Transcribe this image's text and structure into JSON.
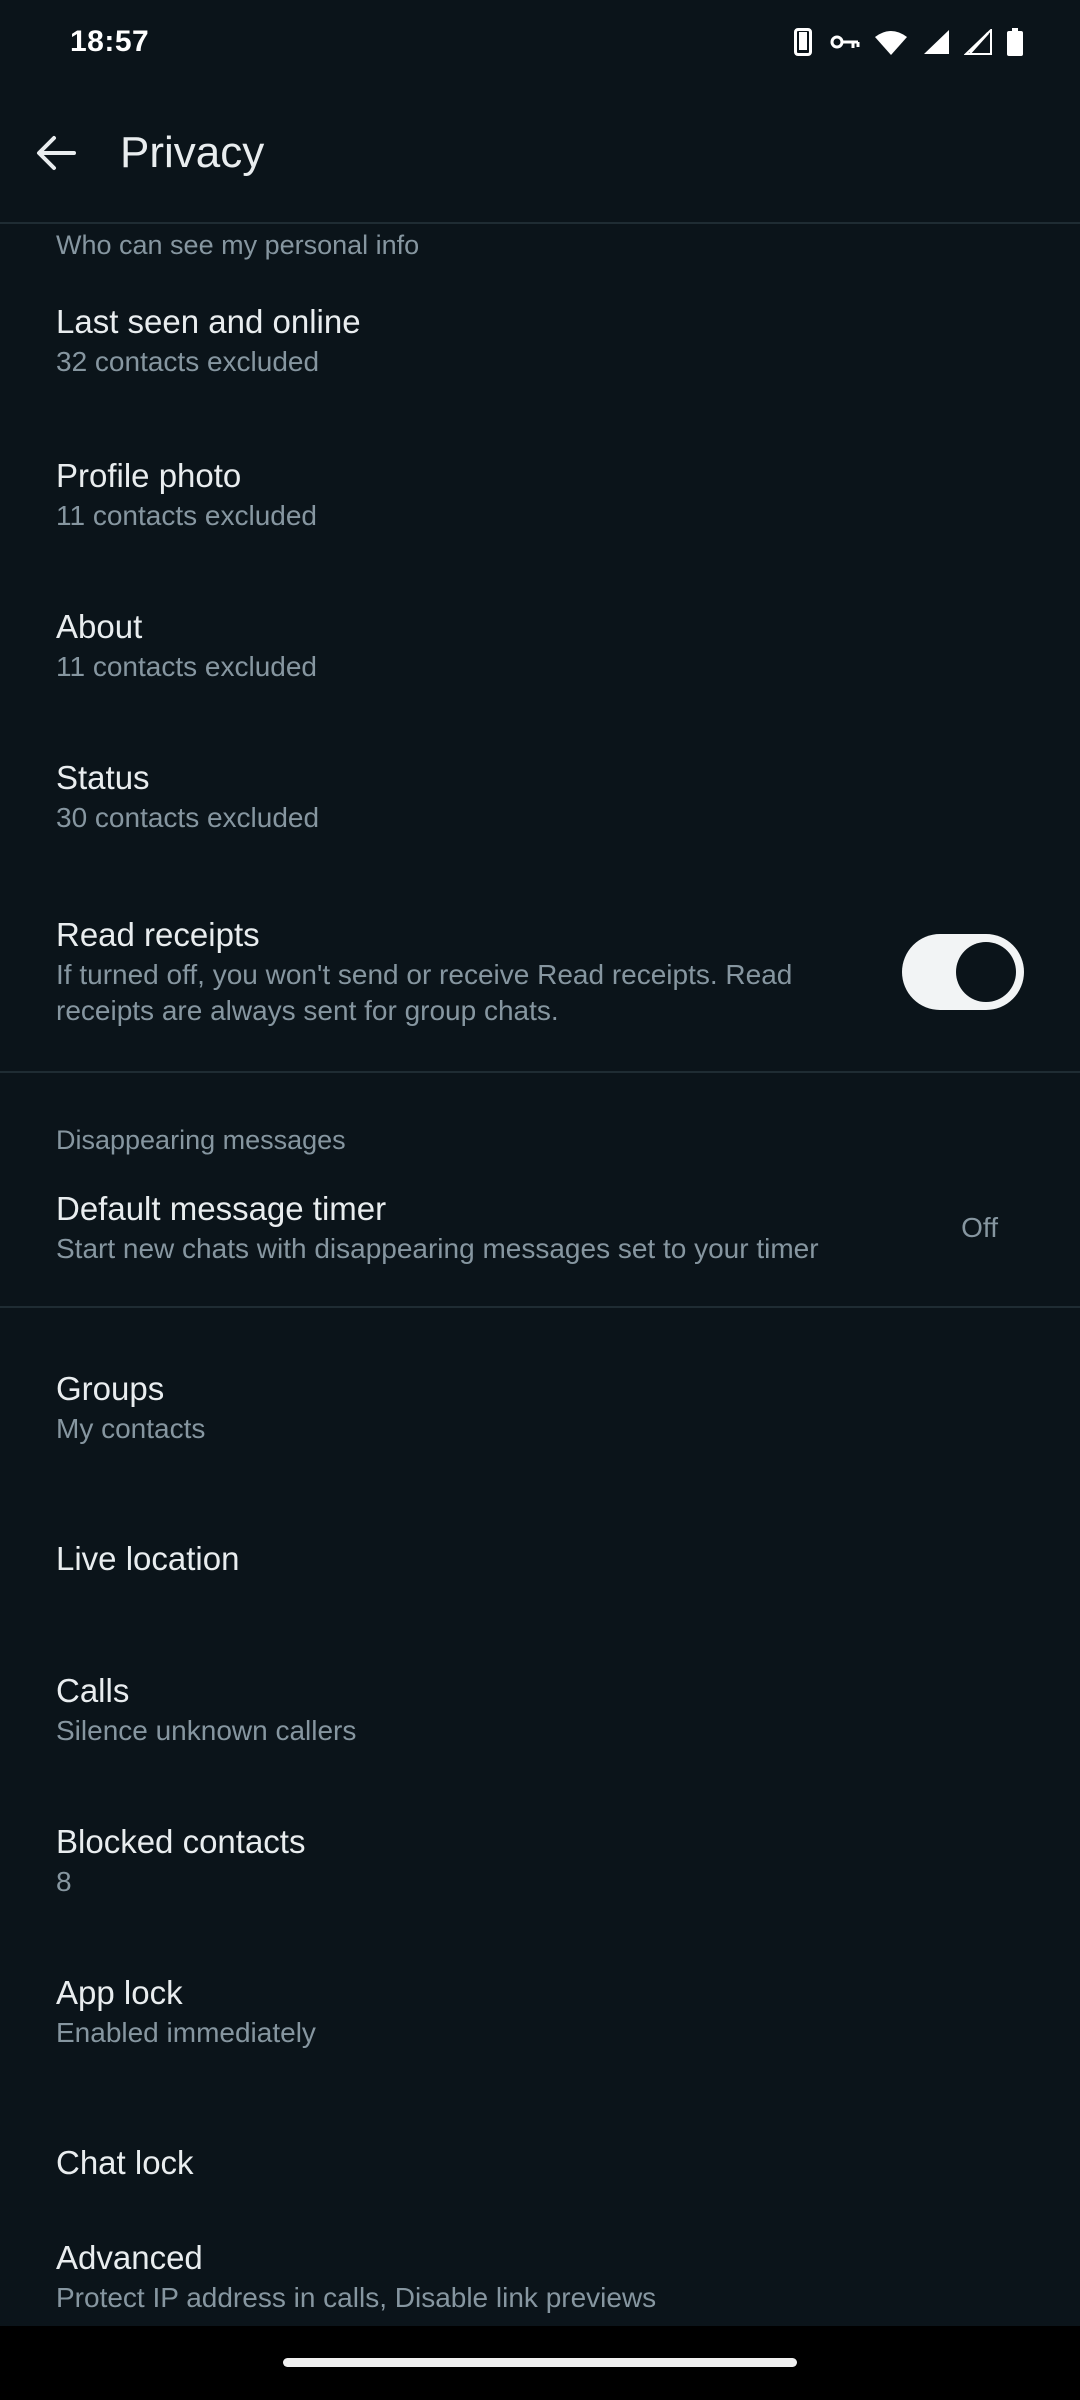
{
  "status_bar": {
    "time": "18:57"
  },
  "app_bar": {
    "title": "Privacy",
    "back_icon": "arrow-left-icon"
  },
  "personal_info": {
    "header": "Who can see my personal info",
    "items": [
      {
        "title": "Last seen and online",
        "subtitle": "32 contacts excluded"
      },
      {
        "title": "Profile photo",
        "subtitle": "11 contacts excluded"
      },
      {
        "title": "About",
        "subtitle": "11 contacts excluded"
      },
      {
        "title": "Status",
        "subtitle": "30 contacts excluded"
      }
    ],
    "read_receipts": {
      "title": "Read receipts",
      "subtitle": "If turned off, you won't send or receive Read receipts. Read receipts are always sent for group chats.",
      "enabled": true
    }
  },
  "disappearing": {
    "header": "Disappearing messages",
    "timer": {
      "title": "Default message timer",
      "subtitle": "Start new chats with disappearing messages set to your timer",
      "value": "Off"
    }
  },
  "other": {
    "items": [
      {
        "title": "Groups",
        "subtitle": "My contacts"
      },
      {
        "title": "Live location",
        "subtitle": ""
      },
      {
        "title": "Calls",
        "subtitle": "Silence unknown callers"
      },
      {
        "title": "Blocked contacts",
        "subtitle": "8"
      },
      {
        "title": "App lock",
        "subtitle": "Enabled immediately"
      },
      {
        "title": "Chat lock",
        "subtitle": ""
      },
      {
        "title": "Advanced",
        "subtitle": "Protect IP address in calls, Disable link previews"
      }
    ]
  },
  "colors": {
    "background": "#0b141a",
    "primary_text": "#e9edef",
    "secondary_text": "#8696a0",
    "divider": "#1f2c33"
  }
}
